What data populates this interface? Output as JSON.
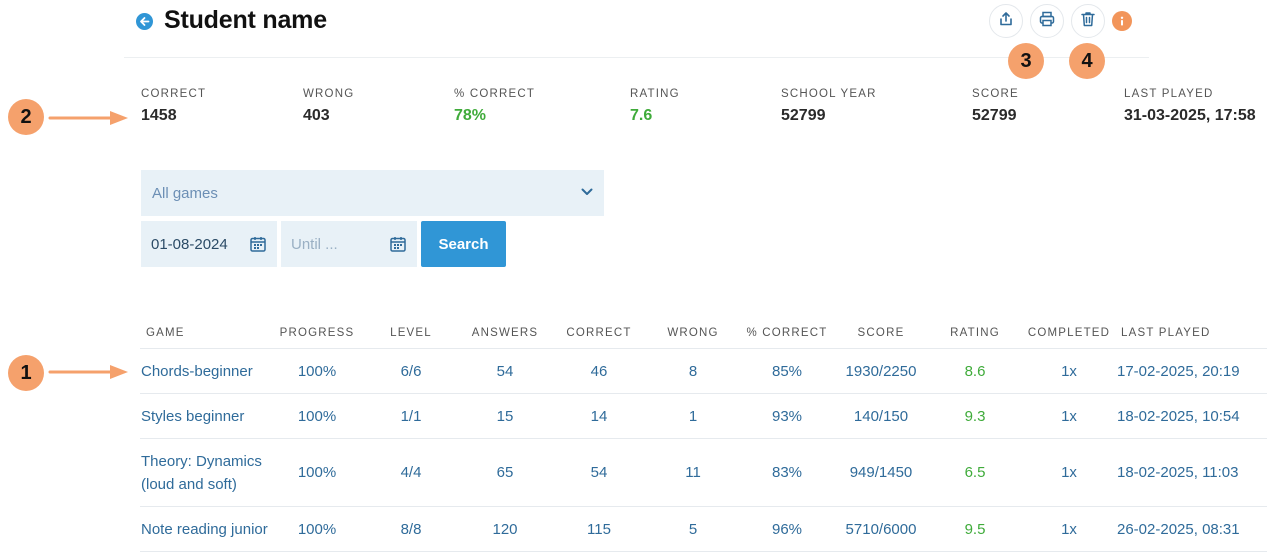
{
  "header": {
    "title": "Student name",
    "icons": {
      "back": "back-arrow-icon",
      "share": "share-icon",
      "print": "printer-icon",
      "delete": "trash-icon",
      "info": "info-icon"
    }
  },
  "markers": [
    "1",
    "2",
    "3",
    "4"
  ],
  "stats": [
    {
      "label": "CORRECT",
      "value": "1458"
    },
    {
      "label": "WRONG",
      "value": "403"
    },
    {
      "label": "% CORRECT",
      "value": "78%"
    },
    {
      "label": "RATING",
      "value": "7.6"
    },
    {
      "label": "SCHOOL YEAR",
      "value": "52799"
    },
    {
      "label": "SCORE",
      "value": "52799"
    },
    {
      "label": "LAST PLAYED",
      "value": "31-03-2025, 17:58"
    }
  ],
  "filters": {
    "game_select": "All games",
    "date_from": "01-08-2024",
    "date_until_placeholder": "Until ...",
    "search_label": "Search"
  },
  "table": {
    "headers": [
      "GAME",
      "PROGRESS",
      "LEVEL",
      "ANSWERS",
      "CORRECT",
      "WRONG",
      "% CORRECT",
      "SCORE",
      "RATING",
      "COMPLETED",
      "LAST PLAYED"
    ],
    "rows": [
      {
        "game": [
          "Chords-beginner"
        ],
        "progress": "100%",
        "level": "6/6",
        "answers": "54",
        "correct": "46",
        "wrong": "8",
        "pct": "85%",
        "score": "1930/2250",
        "rating": "8.6",
        "completed": "1x",
        "last": "17-02-2025, 20:19"
      },
      {
        "game": [
          "Styles beginner"
        ],
        "progress": "100%",
        "level": "1/1",
        "answers": "15",
        "correct": "14",
        "wrong": "1",
        "pct": "93%",
        "score": "140/150",
        "rating": "9.3",
        "completed": "1x",
        "last": "18-02-2025, 10:54"
      },
      {
        "game": [
          "Theory: Dynamics",
          "(loud and soft)"
        ],
        "progress": "100%",
        "level": "4/4",
        "answers": "65",
        "correct": "54",
        "wrong": "11",
        "pct": "83%",
        "score": "949/1450",
        "rating": "6.5",
        "completed": "1x",
        "last": "18-02-2025, 11:03"
      },
      {
        "game": [
          "Note reading junior"
        ],
        "progress": "100%",
        "level": "8/8",
        "answers": "120",
        "correct": "115",
        "wrong": "5",
        "pct": "96%",
        "score": "5710/6000",
        "rating": "9.5",
        "completed": "1x",
        "last": "26-02-2025, 08:31"
      }
    ]
  },
  "colors": {
    "accent": "#3096d6",
    "marker": "#f5a16c",
    "good": "#3fab3a",
    "link": "#2f6b9a"
  }
}
